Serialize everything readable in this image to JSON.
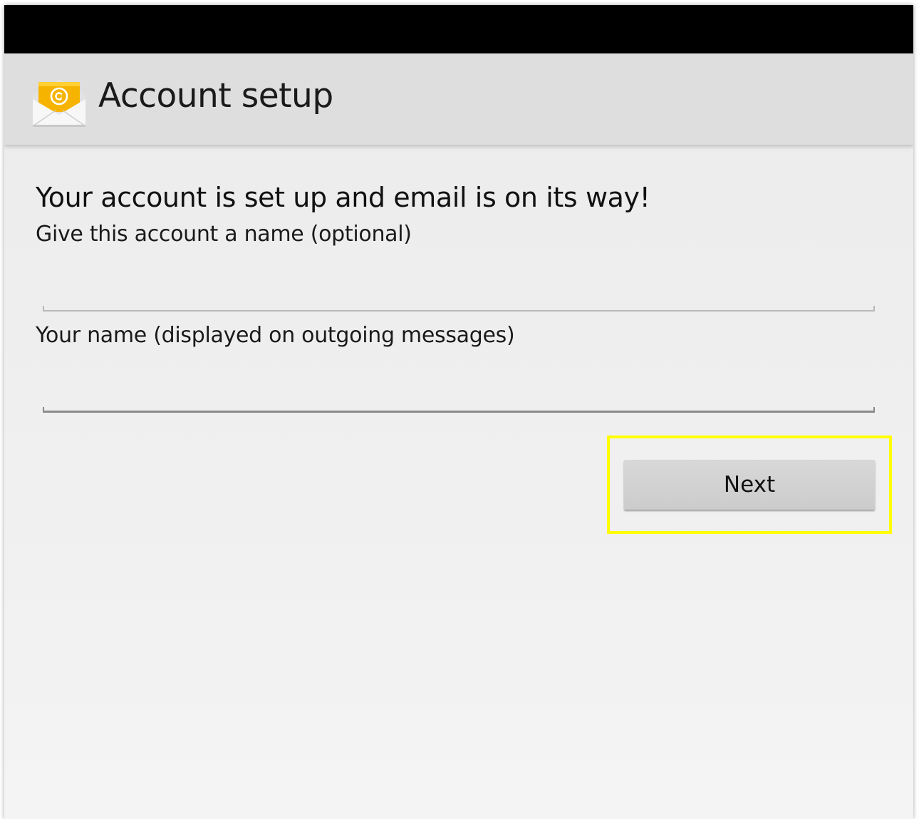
{
  "app": {
    "title": "Account setup",
    "icon": "email-envelope-icon"
  },
  "main": {
    "heading": "Your account is set up and email is on its way!",
    "account_name": {
      "label": "Give this account a name (optional)",
      "value": "",
      "placeholder": ""
    },
    "your_name": {
      "label": "Your name (displayed on outgoing messages)",
      "value": "",
      "placeholder": ""
    },
    "next_button_label": "Next"
  },
  "colors": {
    "status_bar": "#000000",
    "action_bar": "#dedede",
    "highlight": "#ffff00",
    "button": "#d2d2d2",
    "icon_envelope": "#f5f5f5",
    "icon_letter": "#f6b400"
  }
}
